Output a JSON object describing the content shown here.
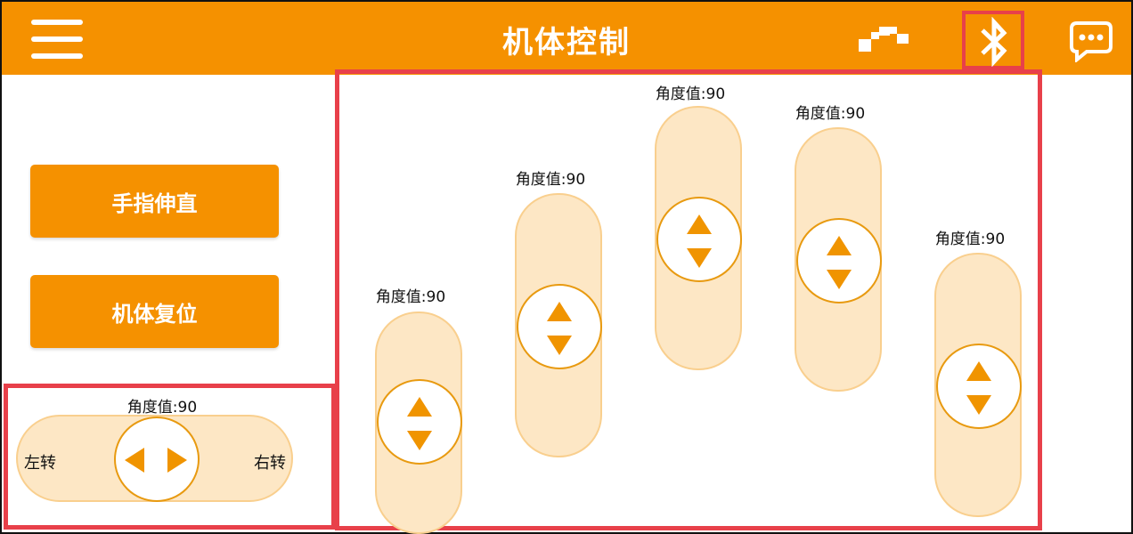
{
  "header": {
    "title": "机体控制",
    "menu_icon": "hamburger-menu-icon",
    "icons": [
      "steps-icon",
      "bluetooth-icon",
      "chat-icon"
    ],
    "accent_color": "#f59100"
  },
  "buttons": {
    "straighten_fingers": "手指伸直",
    "body_reset": "机体复位"
  },
  "base_control": {
    "angle_label": "角度值:90",
    "left_label": "左转",
    "right_label": "右转"
  },
  "servos": [
    {
      "angle_label": "角度值:90"
    },
    {
      "angle_label": "角度值:90"
    },
    {
      "angle_label": "角度值:90"
    },
    {
      "angle_label": "角度值:90"
    },
    {
      "angle_label": "角度值:90"
    }
  ],
  "highlight_color": "#e8404a"
}
